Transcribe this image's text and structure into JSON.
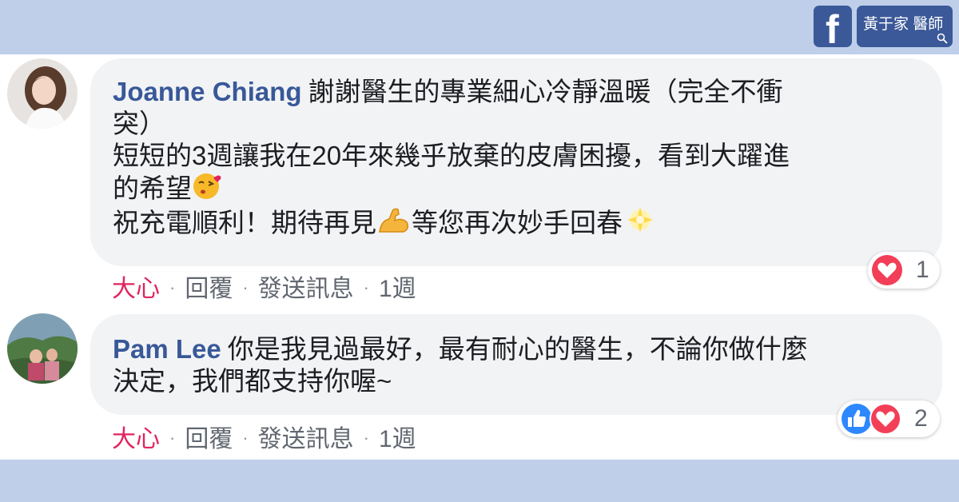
{
  "header": {
    "facebook_logo": "f",
    "page_name": "黃于家 醫師"
  },
  "comments": [
    {
      "author": "Joanne Chiang",
      "lines": [
        "謝謝醫生的專業細心冷靜溫暖（完全不衝",
        "突）",
        "短短的3週讓我在20年來幾乎放棄的皮膚困擾，看到大躍進",
        "的希望",
        "祝充電順利！期待再見",
        "等您再次妙手回春"
      ],
      "emojis": [
        "kiss-emoji",
        "flexed-biceps-emoji",
        "sparkle-star-emoji"
      ],
      "actions": {
        "love": "大心",
        "reply": "回覆",
        "message": "發送訊息",
        "time": "1週"
      },
      "reactions": {
        "icons": [
          "heart-icon"
        ],
        "count": "1"
      }
    },
    {
      "author": "Pam Lee",
      "lines": [
        "你是我見過最好，最有耐心的醫生，不論你做什麼",
        "決定，我們都支持你喔~"
      ],
      "actions": {
        "love": "大心",
        "reply": "回覆",
        "message": "發送訊息",
        "time": "1週"
      },
      "reactions": {
        "icons": [
          "like-icon",
          "heart-icon"
        ],
        "count": "2"
      }
    }
  ],
  "colors": {
    "band": "#bfcfe9",
    "facebook_blue": "#3b5998",
    "author_blue": "#385898",
    "love_red": "#e0245e",
    "bubble_gray": "#f2f3f5"
  }
}
